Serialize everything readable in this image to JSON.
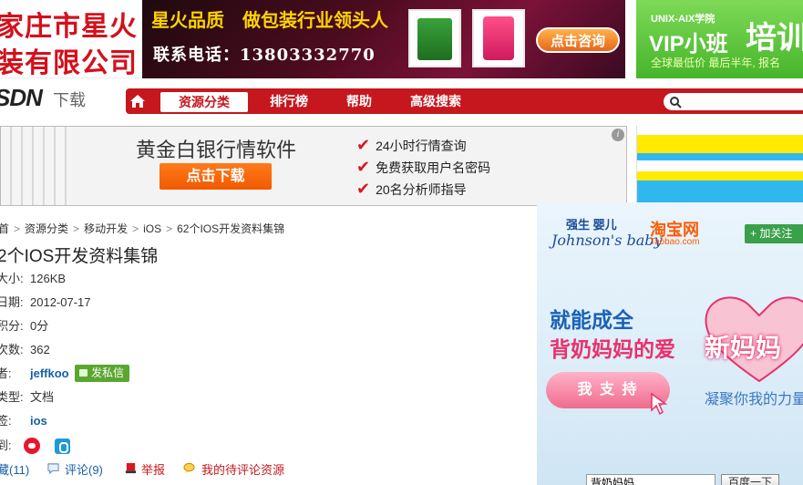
{
  "banners": {
    "left": {
      "line1": "家庄市星火",
      "line2": "装有限公司"
    },
    "mid": {
      "slogan": "星火品质　做包装行业领头人",
      "phone": "联系电话：13803332770",
      "consult": "点击咨询"
    },
    "right": {
      "line1": "UNIX-AIX学院",
      "line2": "VIP小班",
      "line3": "培训",
      "line4": "全球最低价 最后半年, 报名"
    }
  },
  "nav": {
    "logo": "SDN",
    "logo_sub": "下载",
    "items": [
      "资源分类",
      "排行榜",
      "帮助",
      "高级搜索"
    ],
    "active_index": 0,
    "search_placeholder": ""
  },
  "ad": {
    "title": "黄金白银行情软件",
    "button": "点击下载",
    "features": [
      "24小时行情查询",
      "免费获取用户名密码",
      "20名分析师指导"
    ],
    "info": "i"
  },
  "breadcrumb": [
    "首",
    "资源分类",
    "移动开发",
    "iOS",
    "62个IOS开发资料集锦"
  ],
  "title": "2个IOS开发资料集锦",
  "details": [
    {
      "label": "大小:",
      "value": "126KB"
    },
    {
      "label": "日期:",
      "value": "2012-07-17"
    },
    {
      "label": "积分:",
      "value": "0分"
    },
    {
      "label": "次数:",
      "value": "362"
    },
    {
      "label": "者:",
      "value": "jeffkoo"
    },
    {
      "label": "类型:",
      "value": "文档"
    },
    {
      "label": "签:",
      "value": "ios"
    },
    {
      "label": "到:",
      "value": ""
    }
  ],
  "pm_button": "发私信",
  "actions": {
    "favorite": "藏(11)",
    "comment": "评论(9)",
    "report": "举报",
    "pending": "我的待评论资源"
  },
  "side_ad": {
    "brand1": "强生 婴儿",
    "brand1_en": "Johnson's baby",
    "brand2": "淘宝网",
    "brand2_en": "Taobao.com",
    "follow": "+ 加关注",
    "headline1": "就能成全",
    "headline2": "背奶妈妈的爱",
    "heart_text": "新妈妈",
    "support": "我 支 持",
    "tagline": "凝聚你我的力量",
    "search_value": "背奶妈妈",
    "search_button": "百度一下"
  }
}
